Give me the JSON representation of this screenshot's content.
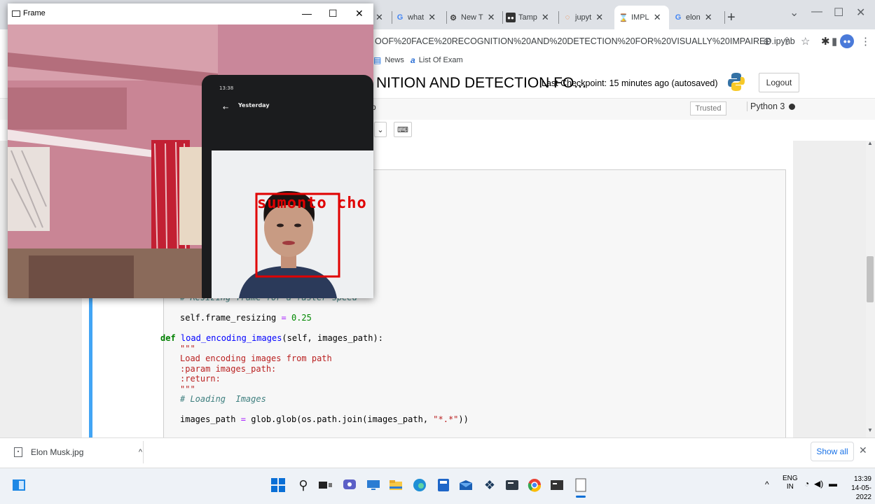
{
  "browser": {
    "tabs": [
      {
        "label": "",
        "icon": "generic-tab-icon"
      },
      {
        "label": "what",
        "icon": "google-icon"
      },
      {
        "label": "New T",
        "icon": "chatbot-icon"
      },
      {
        "label": "Tamp",
        "icon": "tampermonkey-icon"
      },
      {
        "label": "jupyt",
        "icon": "jupyter-icon"
      },
      {
        "label": "IMPL",
        "icon": "hourglass-icon"
      },
      {
        "label": "elon",
        "icon": "google-icon"
      }
    ],
    "url": "OOF%20FACE%20RECOGNITION%20AND%20DETECTION%20FOR%20VISUALLY%20IMPAIRED.ipynb",
    "bookmarks": [
      {
        "label": "News",
        "icon": "news-icon"
      },
      {
        "label": "List Of Exam",
        "icon": "exam-icon"
      }
    ],
    "accent": "#1a73e8"
  },
  "jupyter": {
    "title": "NITION AND DETECTION FO...",
    "checkpoint": "Last Checkpoint: 15 minutes ago  (autosaved)",
    "logout": "Logout",
    "trusted": "Trusted",
    "kernel": "Python 3"
  },
  "code": {
    "comment_resize": "# Resizing frame for a faster speed",
    "frame_resizing_lhs": "self.frame_resizing",
    "frame_resizing_val": "0.25",
    "def_kw": "def",
    "func_name": "load_encoding_images",
    "func_args": "(self, images_path):",
    "doc_open": "\"\"\"",
    "doc_line1": "Load encoding images from path",
    "doc_line2": ":param images_path:",
    "doc_line3": ":return:",
    "doc_close": "\"\"\"",
    "comment_loading": "# Loading  Images",
    "images_path_line_lhs": "images_path",
    "images_path_line_rhs": "glob.glob(os.path.join(images_path, ",
    "images_path_str": "\"*.*\"",
    "images_path_end": "))"
  },
  "download": {
    "filename": "Elon Musk.jpg",
    "show_all": "Show all"
  },
  "frame_window": {
    "title": "Frame",
    "detection_label": "sumonto cho",
    "phone_time": "13:38",
    "phone_header": "Yesterday",
    "detection_color": "#e00000"
  },
  "taskbar": {
    "lang": "ENG",
    "region": "IN",
    "time": "13:39",
    "date": "14-05-2022"
  }
}
